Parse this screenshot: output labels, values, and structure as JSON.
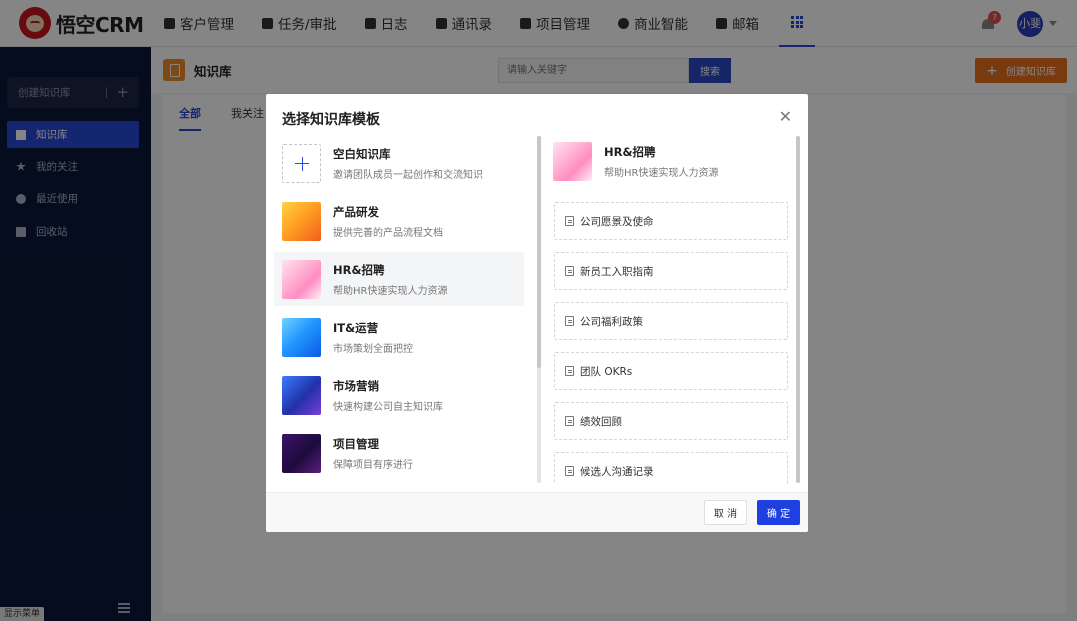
{
  "brand": {
    "name": "悟空CRM"
  },
  "nav": {
    "items": [
      {
        "label": "客户管理",
        "icon": "customer-icon"
      },
      {
        "label": "任务/审批",
        "icon": "briefcase-icon"
      },
      {
        "label": "日志",
        "icon": "log-icon"
      },
      {
        "label": "通讯录",
        "icon": "contacts-icon"
      },
      {
        "label": "项目管理",
        "icon": "project-icon"
      },
      {
        "label": "商业智能",
        "icon": "bi-icon"
      },
      {
        "label": "邮箱",
        "icon": "mail-icon"
      }
    ],
    "notification_count": "7",
    "user": "小斐"
  },
  "sidebar": {
    "create_label": "创建知识库",
    "items": [
      {
        "label": "知识库",
        "active": true
      },
      {
        "label": "我的关注"
      },
      {
        "label": "最近使用"
      },
      {
        "label": "回收站"
      }
    ],
    "show_menu_label": "显示菜单"
  },
  "page": {
    "title": "知识库",
    "search_placeholder": "请输入关键字",
    "search_button": "搜索",
    "create_button": "创建知识库",
    "tabs": [
      "全部",
      "我关注"
    ]
  },
  "modal": {
    "title": "选择知识库模板",
    "templates": [
      {
        "name": "空白知识库",
        "desc": "邀请团队成员一起创作和交流知识"
      },
      {
        "name": "产品研发",
        "desc": "提供完善的产品流程文档"
      },
      {
        "name": "HR&招聘",
        "desc": "帮助HR快速实现人力资源"
      },
      {
        "name": "IT&运营",
        "desc": "市场策划全面把控"
      },
      {
        "name": "市场营销",
        "desc": "快速构建公司自主知识库"
      },
      {
        "name": "项目管理",
        "desc": "保障项目有序进行"
      }
    ],
    "preview": {
      "name": "HR&招聘",
      "desc": "帮助HR快速实现人力资源",
      "docs": [
        "公司愿景及使命",
        "新员工入职指南",
        "公司福利政策",
        "团队 OKRs",
        "绩效回顾",
        "候选人沟通记录"
      ]
    },
    "cancel_label": "取 消",
    "confirm_label": "确 定"
  }
}
